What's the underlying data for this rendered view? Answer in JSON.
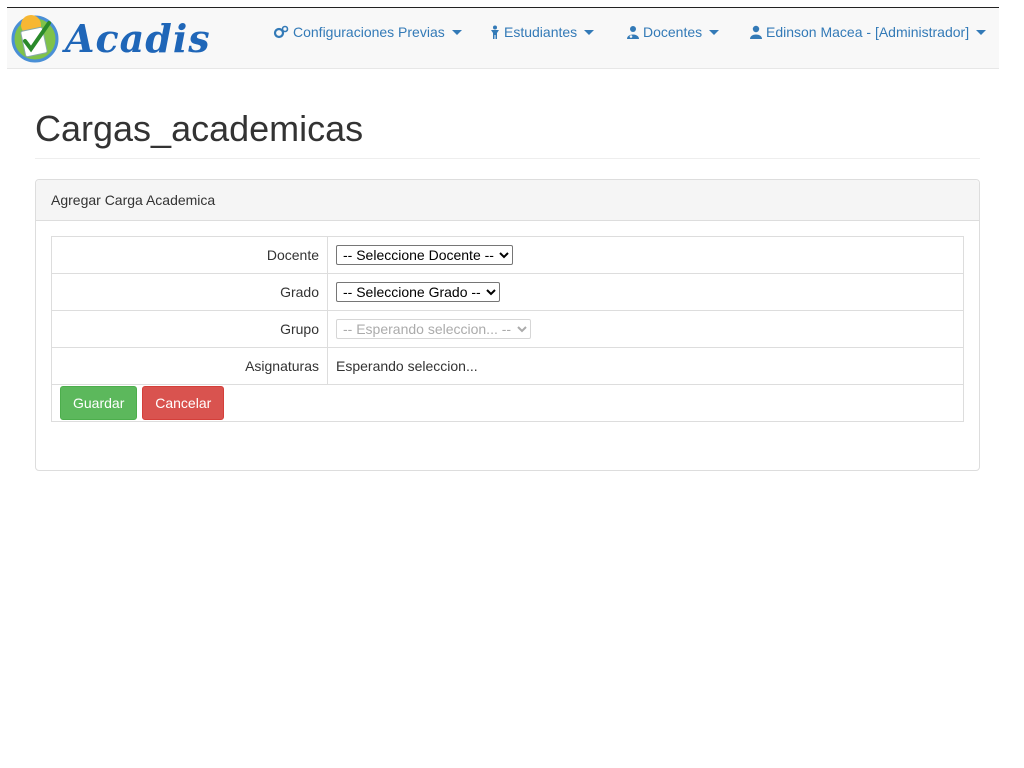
{
  "app": {
    "name": "Acadis"
  },
  "nav": {
    "items": [
      {
        "label": "Configuraciones Previas",
        "icon": "gears-icon"
      },
      {
        "label": "Estudiantes",
        "icon": "child-icon"
      },
      {
        "label": "Docentes",
        "icon": "user-md-icon"
      },
      {
        "label": "Edinson Macea - [Administrador]",
        "icon": "user-icon"
      }
    ]
  },
  "page": {
    "title": "Cargas_academicas"
  },
  "panel": {
    "heading": "Agregar Carga Academica",
    "fields": {
      "docente": {
        "label": "Docente",
        "value": "-- Seleccione Docente --"
      },
      "grado": {
        "label": "Grado",
        "value": "-- Seleccione Grado --"
      },
      "grupo": {
        "label": "Grupo",
        "value": "-- Esperando seleccion... --"
      },
      "asignaturas": {
        "label": "Asignaturas",
        "value": "Esperando seleccion..."
      }
    },
    "buttons": {
      "save": "Guardar",
      "cancel": "Cancelar"
    }
  },
  "colors": {
    "link": "#337ab7",
    "success": "#5cb85c",
    "danger": "#d9534f",
    "brand": "#1f66b8"
  }
}
